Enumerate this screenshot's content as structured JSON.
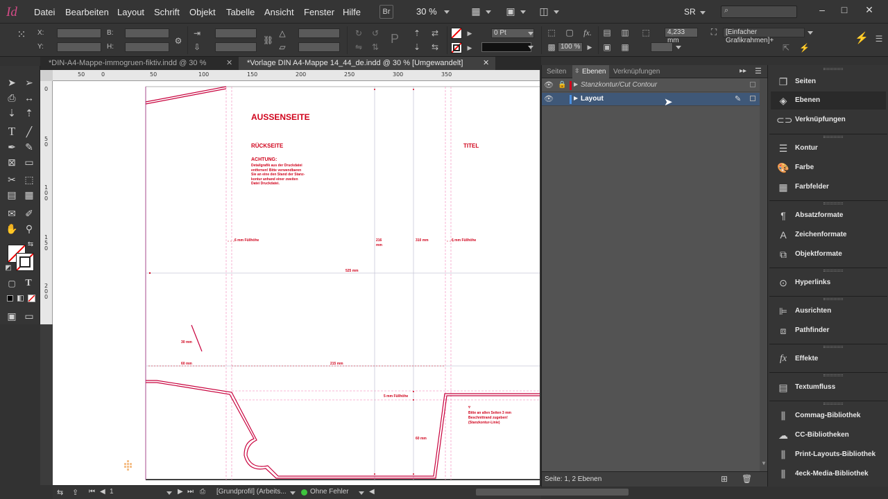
{
  "app": {
    "logo": "Id"
  },
  "menu": [
    "Datei",
    "Bearbeiten",
    "Layout",
    "Schrift",
    "Objekt",
    "Tabelle",
    "Ansicht",
    "Fenster",
    "Hilfe"
  ],
  "menubar": {
    "bridge": "Br",
    "zoom": "30 %",
    "workspace": "SR"
  },
  "control": {
    "x_label": "X:",
    "y_label": "Y:",
    "w_label": "B:",
    "h_label": "H:",
    "stroke_weight": "0 Pt",
    "offset_value": "4,233 mm",
    "frame_style": "[Einfacher Grafikrahmen]+",
    "opacity": "100 %"
  },
  "tabs": [
    {
      "label": "*DIN-A4-Mappe-immogruen-fiktiv.indd @ 30 %",
      "active": false
    },
    {
      "label": "*Vorlage DIN A4-Mappe 14_44_de.indd @ 30 % [Umgewandelt]",
      "active": true
    }
  ],
  "ruler_top": [
    "50",
    "0",
    "50",
    "100",
    "150",
    "200",
    "250",
    "300",
    "350"
  ],
  "ruler_left": [
    "0",
    "5 0",
    "1 0 0",
    "1 5 0",
    "2 0 0",
    "2 5 0",
    "3 0 0",
    "3 5 0"
  ],
  "canvas": {
    "heading": "AUSSENSEITE",
    "back": "RÜCKSEITE",
    "title": "TITEL",
    "warning_title": "ACHTUNG:",
    "warning_lines": [
      "Detailgrafik aus der Druckdatei",
      "entfernen! Bitte verwendbaren",
      "Sie an eine den Stand der Stanz-",
      "kontur anhand einer zweiten",
      "Datei Druckdatei."
    ],
    "dim_fill_left": "6 mm Füllhöhe",
    "dim_fold1": "216",
    "dim_fold1b": "mm",
    "dim_fold2": "310 mm",
    "dim_fill_right": "6 mm Füllhöhe",
    "dim_total": "525 mm",
    "dim_diag": "30 mm",
    "dim_flap": "60 mm",
    "dim_width": "215 mm",
    "dim_fill_bottom": "5 mm Füllhöhe",
    "dim_bottom": "60 mm",
    "note_lines": [
      "Bitte an allen Seiten 3 mm",
      "Beschnittrand zugeben!",
      "(Stanzkontur-Linie)"
    ]
  },
  "status": {
    "page": "1",
    "profile": "[Grundprofil] (Arbeits...",
    "errors": "Ohne Fehler"
  },
  "layers_panel": {
    "tabs": [
      "Seiten",
      "Ebenen",
      "Verknüpfungen"
    ],
    "layers": [
      {
        "name": "Stanzkontur/Cut Contour",
        "color": "#d0021b",
        "locked": true,
        "selected": false
      },
      {
        "name": "Layout",
        "color": "#4a90e2",
        "locked": false,
        "selected": true
      }
    ],
    "footer": "Seite: 1, 2 Ebenen"
  },
  "dock": [
    {
      "label": "Seiten",
      "icon": "pages-icon"
    },
    {
      "label": "Ebenen",
      "icon": "layers-icon"
    },
    {
      "label": "Verknüpfungen",
      "icon": "links-icon"
    },
    {
      "label": "Kontur",
      "icon": "stroke-icon"
    },
    {
      "label": "Farbe",
      "icon": "color-icon"
    },
    {
      "label": "Farbfelder",
      "icon": "swatches-icon"
    },
    {
      "label": "Absatzformate",
      "icon": "paragraph-styles-icon"
    },
    {
      "label": "Zeichenformate",
      "icon": "character-styles-icon"
    },
    {
      "label": "Objektformate",
      "icon": "object-styles-icon"
    },
    {
      "label": "Hyperlinks",
      "icon": "hyperlinks-icon"
    },
    {
      "label": "Ausrichten",
      "icon": "align-icon"
    },
    {
      "label": "Pathfinder",
      "icon": "pathfinder-icon"
    },
    {
      "label": "Effekte",
      "icon": "effects-icon"
    },
    {
      "label": "Textumfluss",
      "icon": "text-wrap-icon"
    },
    {
      "label": "Commag-Bibliothek",
      "icon": "library-icon"
    },
    {
      "label": "CC-Bibliotheken",
      "icon": "cc-libraries-icon"
    },
    {
      "label": "Print-Layouts-Bibliothek",
      "icon": "library-icon"
    },
    {
      "label": "4eck-Media-Bibliothek",
      "icon": "library-icon"
    }
  ]
}
